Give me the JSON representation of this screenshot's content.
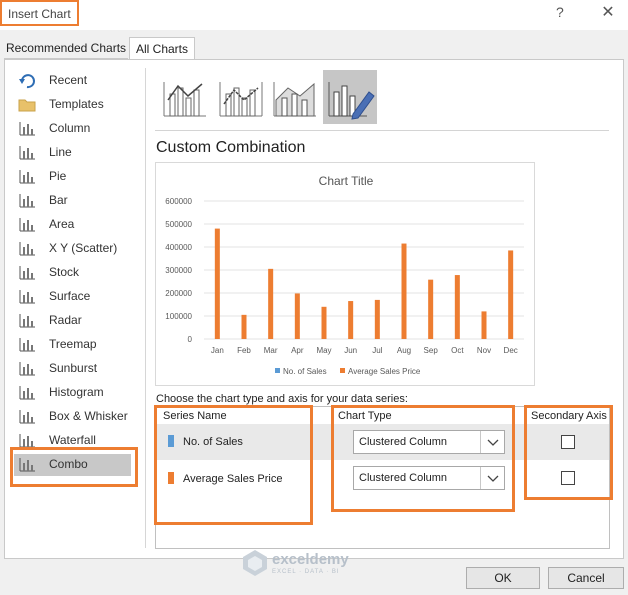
{
  "window": {
    "title": "Insert Chart",
    "help": "?",
    "close": "✕"
  },
  "tabs": [
    {
      "label": "Recommended Charts"
    },
    {
      "label": "All Charts"
    }
  ],
  "sidebar": {
    "items": [
      {
        "label": "Recent",
        "icon": "recent-icon"
      },
      {
        "label": "Templates",
        "icon": "folder-icon"
      },
      {
        "label": "Column",
        "icon": "column-chart-icon"
      },
      {
        "label": "Line",
        "icon": "line-chart-icon"
      },
      {
        "label": "Pie",
        "icon": "pie-chart-icon"
      },
      {
        "label": "Bar",
        "icon": "bar-chart-icon"
      },
      {
        "label": "Area",
        "icon": "area-chart-icon"
      },
      {
        "label": "X Y (Scatter)",
        "icon": "scatter-chart-icon"
      },
      {
        "label": "Stock",
        "icon": "stock-chart-icon"
      },
      {
        "label": "Surface",
        "icon": "surface-chart-icon"
      },
      {
        "label": "Radar",
        "icon": "radar-chart-icon"
      },
      {
        "label": "Treemap",
        "icon": "treemap-chart-icon"
      },
      {
        "label": "Sunburst",
        "icon": "sunburst-chart-icon"
      },
      {
        "label": "Histogram",
        "icon": "histogram-chart-icon"
      },
      {
        "label": "Box & Whisker",
        "icon": "box-whisker-chart-icon"
      },
      {
        "label": "Waterfall",
        "icon": "waterfall-chart-icon"
      },
      {
        "label": "Combo",
        "icon": "combo-chart-icon",
        "selected": true
      }
    ]
  },
  "main": {
    "section_title": "Custom Combination",
    "instruction": "Choose the chart type and axis for your data series:",
    "headers": {
      "series_name": "Series Name",
      "chart_type": "Chart Type",
      "secondary_axis": "Secondary Axis"
    },
    "series_rows": [
      {
        "name": "No. of Sales",
        "color": "#5b9bd5",
        "chart_type": "Clustered Column",
        "secondary_axis": false
      },
      {
        "name": "Average Sales Price",
        "color": "#ed7d31",
        "chart_type": "Clustered Column",
        "secondary_axis": false
      }
    ]
  },
  "chart_data": {
    "type": "bar",
    "title": "Chart Title",
    "categories": [
      "Jan",
      "Feb",
      "Mar",
      "Apr",
      "May",
      "Jun",
      "Jul",
      "Aug",
      "Sep",
      "Oct",
      "Nov",
      "Dec"
    ],
    "y_ticks": [
      "0",
      "100000",
      "200000",
      "300000",
      "400000",
      "500000",
      "600000"
    ],
    "ylim": [
      0,
      600000
    ],
    "grid": true,
    "legend_position": "bottom",
    "series": [
      {
        "name": "No. of Sales",
        "color": "#5b9bd5",
        "values": [
          0,
          0,
          0,
          0,
          0,
          0,
          0,
          0,
          0,
          0,
          0,
          0
        ]
      },
      {
        "name": "Average Sales Price",
        "color": "#ed7d31",
        "values": [
          480000,
          105000,
          305000,
          198000,
          140000,
          165000,
          170000,
          415000,
          258000,
          278000,
          120000,
          385000
        ]
      }
    ]
  },
  "buttons": {
    "ok": "OK",
    "cancel": "Cancel"
  },
  "watermark": {
    "name": "exceldemy",
    "tagline": "EXCEL · DATA · BI"
  },
  "accent_color": "#ed7d31"
}
